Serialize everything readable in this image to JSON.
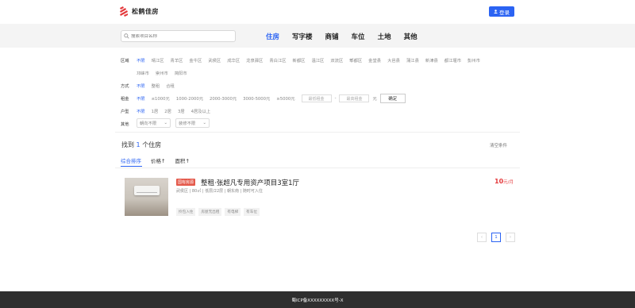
{
  "brand": {
    "name": "松鹤佳房",
    "color": "#e4393c"
  },
  "header": {
    "login_label": "登录",
    "login_icon": "user-icon",
    "accent": "#2b63f3"
  },
  "nav": {
    "search_placeholder": "搜索项目名称",
    "tabs": [
      "住房",
      "写字楼",
      "商铺",
      "车位",
      "土地",
      "其他"
    ],
    "active_tab": "住房"
  },
  "filters": {
    "district_label": "区域",
    "districts": [
      "不限",
      "晴江区",
      "青羊区",
      "金牛区",
      "武侯区",
      "成华区",
      "龙泉驿区",
      "青白江区",
      "新都区",
      "温江区",
      "双流区",
      "郫都区",
      "金堂县",
      "大邑县",
      "蒲江县",
      "新津县",
      "都江堰市",
      "彭州市",
      "邛崃市",
      "崇州市",
      "简阳市"
    ],
    "mode_label": "方式",
    "modes": [
      "不限",
      "整租",
      "合租"
    ],
    "rent_label": "租金",
    "rents": [
      "不限",
      "≤1000元",
      "1000-2000元",
      "2000-3000元",
      "3000-5000元",
      "≥5000元"
    ],
    "rent_min_placeholder": "最低租金",
    "rent_max_placeholder": "最高租金",
    "rent_sep": "-",
    "rent_unit": "元",
    "confirm_label": "确定",
    "layout_label": "户型",
    "layouts": [
      "不限",
      "1居",
      "2居",
      "3居",
      "4居及以上"
    ],
    "other_label": "其他",
    "orientation": "朝向不限",
    "decoration": "装修不限"
  },
  "results": {
    "prefix": "找到",
    "count": "1",
    "suffix": "个住房",
    "clear_label": "清空条件",
    "sorts": [
      "综合排序",
      "价格↑",
      "面积↑"
    ]
  },
  "listing": {
    "badge": "国有房源",
    "title": "整租·张超凡专用资产项目3室1厅",
    "meta": "武侯区 | 80㎡ | 低层/22层 | 朝东南 | 随时可入住",
    "tags": [
      "拎包入住",
      "房屋无出租",
      "有电梯",
      "有车位"
    ],
    "price": "10",
    "price_unit": "元/月"
  },
  "pager": {
    "prev": "‹",
    "current": "1",
    "next": "›"
  },
  "footer": {
    "text": "蜀ICP备XXXXXXXXX号-X"
  }
}
